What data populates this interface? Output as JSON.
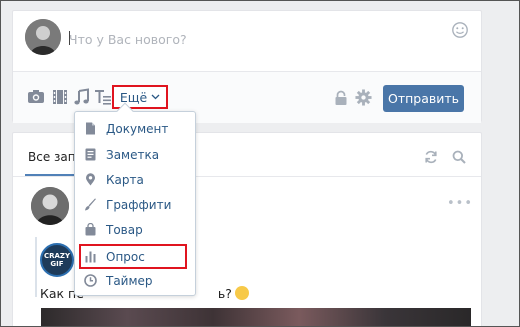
{
  "composer": {
    "placeholder": "Что у Вас нового?",
    "more_label": "Ещё",
    "send_label": "Отправить"
  },
  "attach_icons": [
    "camera-icon",
    "video-icon",
    "music-icon",
    "text-format-icon"
  ],
  "dropdown": {
    "items": [
      {
        "label": "Документ",
        "icon": "document-icon"
      },
      {
        "label": "Заметка",
        "icon": "note-icon"
      },
      {
        "label": "Карта",
        "icon": "map-pin-icon"
      },
      {
        "label": "Граффити",
        "icon": "brush-icon"
      },
      {
        "label": "Товар",
        "icon": "bag-icon"
      },
      {
        "label": "Опрос",
        "icon": "poll-icon"
      },
      {
        "label": "Таймер",
        "icon": "clock-icon"
      }
    ]
  },
  "feed": {
    "tab_label": "Все запи",
    "post_text_start": "Как пе",
    "post_text_end": "ь?",
    "gif_badge": [
      "CRAZY",
      "GIF"
    ],
    "more_dots": "•••"
  },
  "colors": {
    "accent": "#4a76a8",
    "link": "#2a5885",
    "highlight_box": "#e0141f",
    "icon_gray": "#828a99"
  }
}
